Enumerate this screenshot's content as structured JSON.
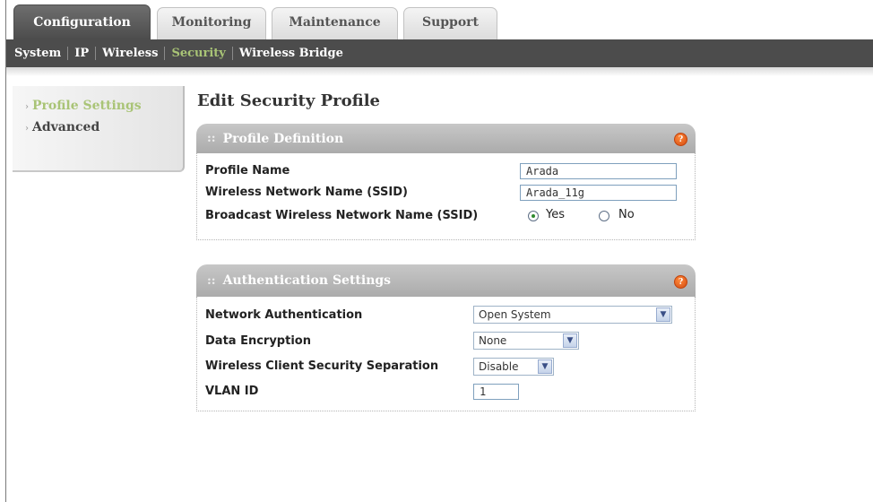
{
  "tabs": [
    {
      "label": "Configuration",
      "active": true
    },
    {
      "label": "Monitoring",
      "active": false
    },
    {
      "label": "Maintenance",
      "active": false
    },
    {
      "label": "Support",
      "active": false
    }
  ],
  "subnav": [
    {
      "label": "System",
      "active": false
    },
    {
      "label": "IP",
      "active": false
    },
    {
      "label": "Wireless",
      "active": false
    },
    {
      "label": "Security",
      "active": true
    },
    {
      "label": "Wireless Bridge",
      "active": false
    }
  ],
  "sidemenu": [
    {
      "label": "Profile Settings",
      "active": true
    },
    {
      "label": "Advanced",
      "active": false
    }
  ],
  "page_title": "Edit Security Profile",
  "profile_definition": {
    "title": "Profile Definition",
    "help_icon": "help-icon",
    "profile_name_label": "Profile Name",
    "profile_name_value": "Arada",
    "ssid_label": "Wireless Network Name (SSID)",
    "ssid_value": "Arada_11g",
    "broadcast_label": "Broadcast Wireless Network Name (SSID)",
    "broadcast_yes": "Yes",
    "broadcast_no": "No",
    "broadcast_selected": "Yes"
  },
  "authentication": {
    "title": "Authentication Settings",
    "help_icon": "help-icon",
    "network_auth_label": "Network Authentication",
    "network_auth_value": "Open System",
    "data_encryption_label": "Data Encryption",
    "data_encryption_value": "None",
    "separation_label": "Wireless Client Security Separation",
    "separation_value": "Disable",
    "vlan_label": "VLAN ID",
    "vlan_value": "1"
  },
  "colors": {
    "active_green": "#a9c476",
    "subnav_bg": "#4c4c4c",
    "help_orange": "#e2621f"
  }
}
